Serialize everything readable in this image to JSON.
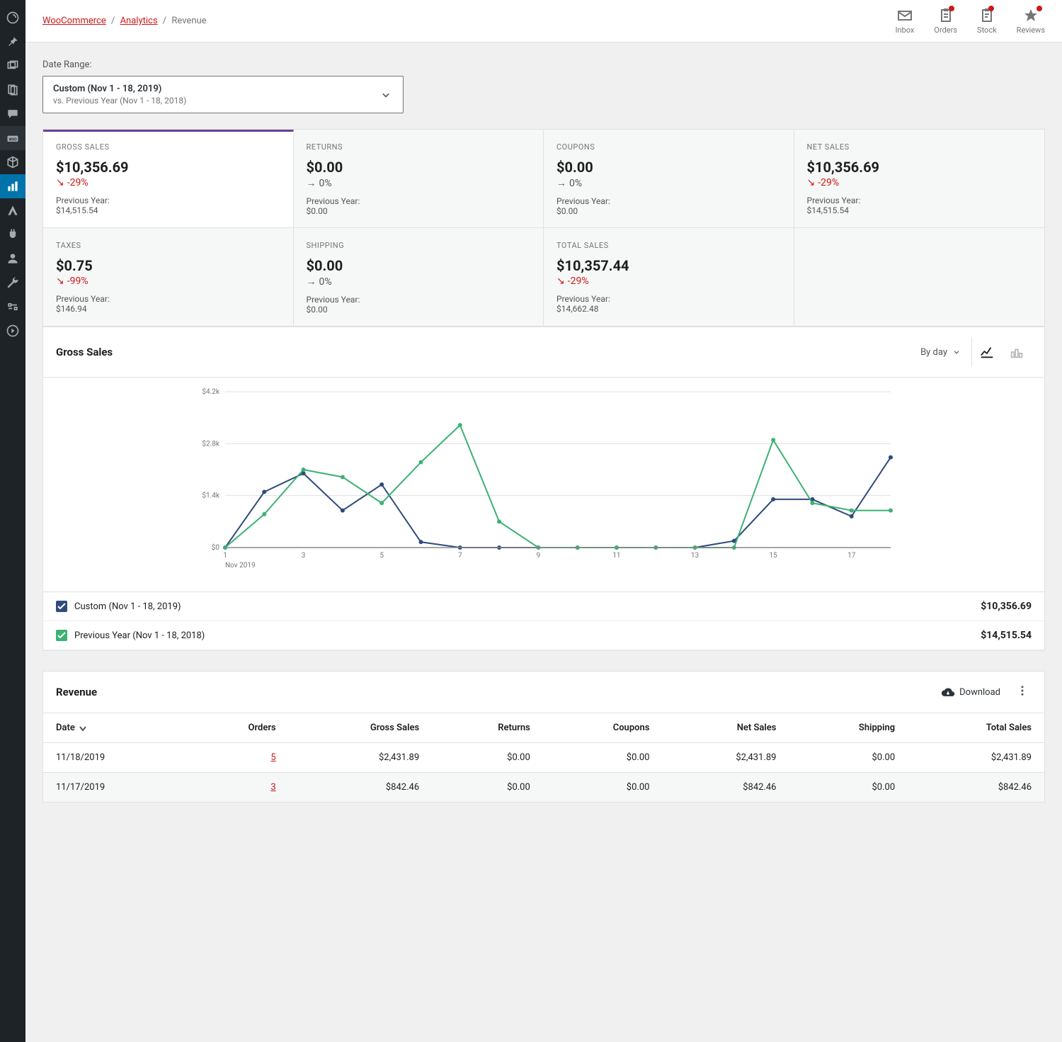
{
  "breadcrumb": {
    "root": "WooCommerce",
    "section": "Analytics",
    "page": "Revenue"
  },
  "top_actions": {
    "inbox": "Inbox",
    "orders": "Orders",
    "stock": "Stock",
    "reviews": "Reviews"
  },
  "date_range": {
    "label": "Date Range:",
    "title": "Custom (Nov 1 - 18, 2019)",
    "subtitle": "vs. Previous Year (Nov 1 - 18, 2018)"
  },
  "kpis": [
    {
      "label": "GROSS SALES",
      "value": "$10,356.69",
      "delta": "-29%",
      "dir": "down",
      "prev_label": "Previous Year:",
      "prev_val": "$14,515.54",
      "active": true
    },
    {
      "label": "RETURNS",
      "value": "$0.00",
      "delta": "0%",
      "dir": "neutral",
      "prev_label": "Previous Year:",
      "prev_val": "$0.00"
    },
    {
      "label": "COUPONS",
      "value": "$0.00",
      "delta": "0%",
      "dir": "neutral",
      "prev_label": "Previous Year:",
      "prev_val": "$0.00"
    },
    {
      "label": "NET SALES",
      "value": "$10,356.69",
      "delta": "-29%",
      "dir": "down",
      "prev_label": "Previous Year:",
      "prev_val": "$14,515.54"
    },
    {
      "label": "TAXES",
      "value": "$0.75",
      "delta": "-99%",
      "dir": "down",
      "prev_label": "Previous Year:",
      "prev_val": "$146.94"
    },
    {
      "label": "SHIPPING",
      "value": "$0.00",
      "delta": "0%",
      "dir": "neutral",
      "prev_label": "Previous Year:",
      "prev_val": "$0.00"
    },
    {
      "label": "TOTAL SALES",
      "value": "$10,357.44",
      "delta": "-29%",
      "dir": "down",
      "prev_label": "Previous Year:",
      "prev_val": "$14,662.48"
    }
  ],
  "chart": {
    "title": "Gross Sales",
    "interval": "By day",
    "legend": [
      {
        "label": "Custom (Nov 1 - 18, 2019)",
        "value": "$10,356.69",
        "color": "#2f4b7c"
      },
      {
        "label": "Previous Year (Nov 1 - 18, 2018)",
        "value": "$14,515.54",
        "color": "#3bb273"
      }
    ],
    "x_month": "Nov 2019",
    "y_ticks": [
      "$0",
      "$1.4k",
      "$2.8k",
      "$4.2k"
    ]
  },
  "chart_data": {
    "type": "line",
    "title": "Gross Sales",
    "xlabel": "Nov 2019",
    "ylabel": "",
    "ylim": [
      0,
      4200
    ],
    "categories": [
      1,
      2,
      3,
      4,
      5,
      6,
      7,
      8,
      9,
      10,
      11,
      12,
      13,
      14,
      15,
      16,
      17,
      18
    ],
    "series": [
      {
        "name": "Custom (Nov 1 - 18, 2019)",
        "color": "#2f4b7c",
        "values": [
          0,
          1500,
          2000,
          1000,
          1700,
          150,
          0,
          0,
          0,
          0,
          0,
          0,
          0,
          180,
          1300,
          1300,
          842,
          2432
        ]
      },
      {
        "name": "Previous Year (Nov 1 - 18, 2018)",
        "color": "#3bb273",
        "values": [
          0,
          900,
          2100,
          1900,
          1200,
          2300,
          3300,
          700,
          0,
          0,
          0,
          0,
          0,
          0,
          2900,
          1200,
          1000,
          1000
        ]
      }
    ]
  },
  "table": {
    "title": "Revenue",
    "download": "Download",
    "columns": [
      "Date",
      "Orders",
      "Gross Sales",
      "Returns",
      "Coupons",
      "Net Sales",
      "Shipping",
      "Total Sales"
    ],
    "rows": [
      {
        "date": "11/18/2019",
        "orders": "5",
        "gross": "$2,431.89",
        "returns": "$0.00",
        "coupons": "$0.00",
        "net": "$2,431.89",
        "shipping": "$0.00",
        "total": "$2,431.89"
      },
      {
        "date": "11/17/2019",
        "orders": "3",
        "gross": "$842.46",
        "returns": "$0.00",
        "coupons": "$0.00",
        "net": "$842.46",
        "shipping": "$0.00",
        "total": "$842.46"
      }
    ]
  }
}
